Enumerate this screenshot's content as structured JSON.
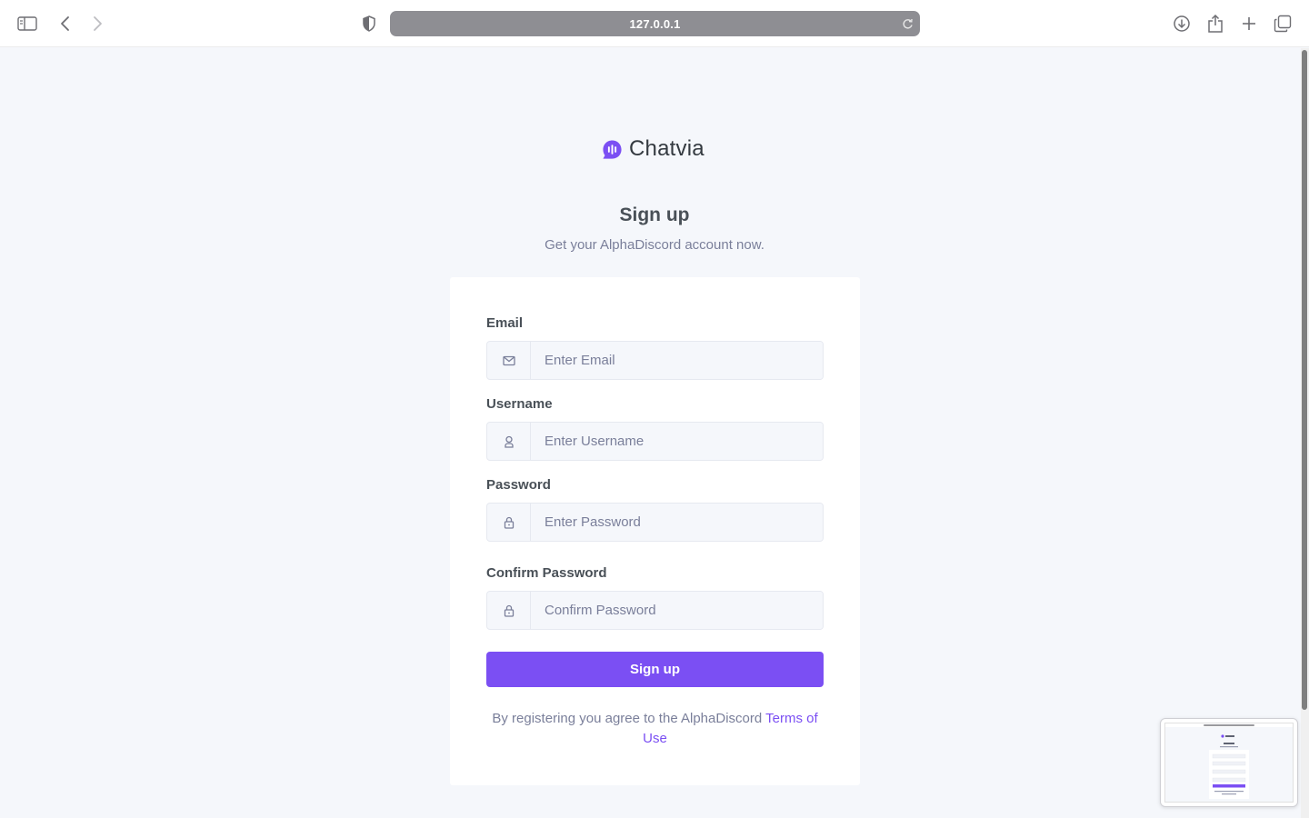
{
  "browser": {
    "url": "127.0.0.1",
    "icons": [
      "sidebar-toggle-icon",
      "back-icon",
      "forward-icon",
      "privacy-shield-icon",
      "reload-icon",
      "download-icon",
      "share-icon",
      "new-tab-icon",
      "tabs-overview-icon"
    ]
  },
  "brand": {
    "name": "Chatvia",
    "logo_icon": "chat-bubble-logo-icon",
    "accent": "#7b4ff3"
  },
  "signup": {
    "title": "Sign up",
    "subtitle": "Get your AlphaDiscord account now.",
    "fields": {
      "email": {
        "label": "Email",
        "placeholder": "Enter Email",
        "value": "",
        "icon": "mail-icon"
      },
      "username": {
        "label": "Username",
        "placeholder": "Enter Username",
        "value": "",
        "icon": "user-icon"
      },
      "password": {
        "label": "Password",
        "placeholder": "Enter Password",
        "value": "",
        "icon": "lock-icon"
      },
      "confirm_password": {
        "label": "Confirm Password",
        "placeholder": "Confirm Password",
        "value": "",
        "icon": "lock-icon"
      }
    },
    "submit_label": "Sign up",
    "terms_text": "By registering you agree to the AlphaDiscord ",
    "terms_link": "Terms of Use"
  }
}
